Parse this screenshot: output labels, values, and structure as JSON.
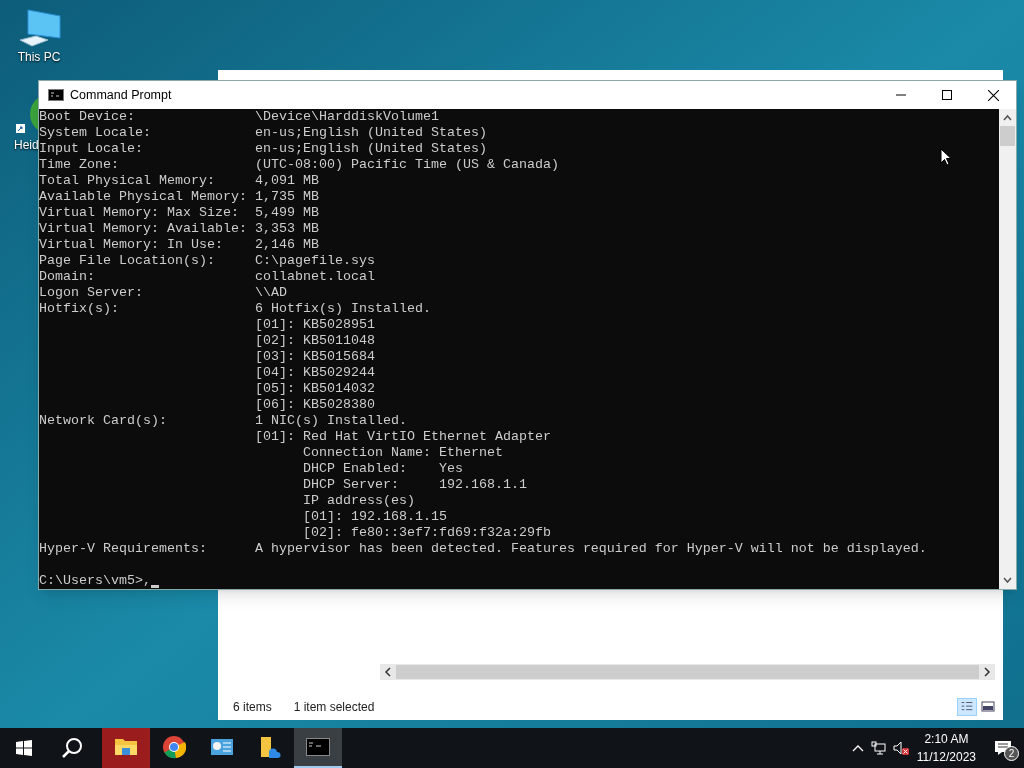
{
  "desktop_icons": [
    {
      "label": "This PC",
      "kind": "pc"
    },
    {
      "label": "Heid",
      "kind": "app"
    }
  ],
  "explorer": {
    "status": [
      "6 items",
      "1 item selected"
    ]
  },
  "console": {
    "title": "Command Prompt",
    "lines": [
      "Boot Device:               \\Device\\HarddiskVolume1",
      "System Locale:             en-us;English (United States)",
      "Input Locale:              en-us;English (United States)",
      "Time Zone:                 (UTC-08:00) Pacific Time (US & Canada)",
      "Total Physical Memory:     4,091 MB",
      "Available Physical Memory: 1,735 MB",
      "Virtual Memory: Max Size:  5,499 MB",
      "Virtual Memory: Available: 3,353 MB",
      "Virtual Memory: In Use:    2,146 MB",
      "Page File Location(s):     C:\\pagefile.sys",
      "Domain:                    collabnet.local",
      "Logon Server:              \\\\AD",
      "Hotfix(s):                 6 Hotfix(s) Installed.",
      "                           [01]: KB5028951",
      "                           [02]: KB5011048",
      "                           [03]: KB5015684",
      "                           [04]: KB5029244",
      "                           [05]: KB5014032",
      "                           [06]: KB5028380",
      "Network Card(s):           1 NIC(s) Installed.",
      "                           [01]: Red Hat VirtIO Ethernet Adapter",
      "                                 Connection Name: Ethernet",
      "                                 DHCP Enabled:    Yes",
      "                                 DHCP Server:     192.168.1.1",
      "                                 IP address(es)",
      "                                 [01]: 192.168.1.15",
      "                                 [02]: fe80::3ef7:fd69:f32a:29fb",
      "Hyper-V Requirements:      A hypervisor has been detected. Features required for Hyper-V will not be displayed."
    ],
    "prompt": "C:\\Users\\vm5>,"
  },
  "taskbar": {
    "apps": [
      {
        "kind": "explorer",
        "selected": false
      },
      {
        "kind": "chrome",
        "selected": false
      },
      {
        "kind": "control",
        "selected": false
      },
      {
        "kind": "folder",
        "selected": false
      },
      {
        "kind": "cmd",
        "selected": true
      }
    ],
    "time": "2:10 AM",
    "date": "11/12/2023",
    "notifications": "2"
  }
}
